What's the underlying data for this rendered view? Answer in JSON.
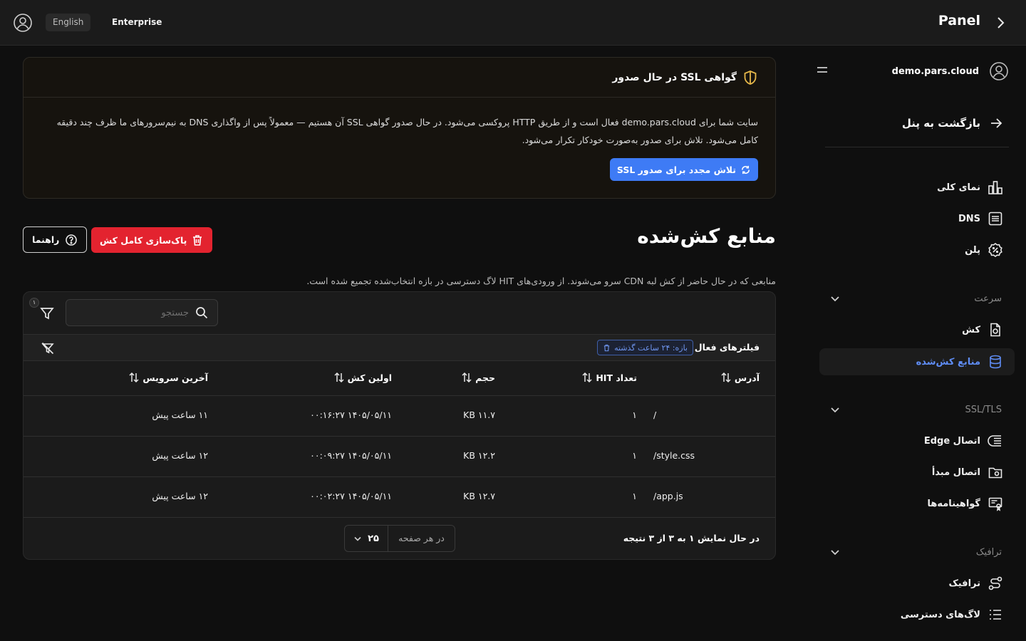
{
  "topbar": {
    "language": "English",
    "plan": "Enterprise",
    "title": "Panel"
  },
  "sidebar": {
    "domain": "demo.pars.cloud",
    "back_label": "بازگشت به پنل",
    "items": [
      {
        "label": "نمای کلی",
        "icon": "chart-bar-icon"
      },
      {
        "label": "DNS",
        "icon": "list-document-icon"
      },
      {
        "label": "پلن",
        "icon": "badge-percent-icon"
      }
    ],
    "groups": [
      {
        "label": "سرعت",
        "items": [
          {
            "label": "کش",
            "icon": "cache-file-icon"
          },
          {
            "label": "منابع کش‌شده",
            "icon": "database-icon",
            "active": true
          }
        ]
      },
      {
        "label": "SSL/TLS",
        "items": [
          {
            "label": "اتصال Edge",
            "icon": "edge-lines-icon"
          },
          {
            "label": "اتصال مبدأ",
            "icon": "folder-icon"
          },
          {
            "label": "گواهینامه‌ها",
            "icon": "certificate-icon"
          }
        ]
      },
      {
        "label": "ترافیک",
        "items": [
          {
            "label": "ترافیک",
            "icon": "route-icon"
          },
          {
            "label": "لاگ‌های دسترسی",
            "icon": "log-list-icon"
          }
        ]
      }
    ]
  },
  "ssl_notice": {
    "title": "گواهی SSL در حال صدور",
    "body": "سایت شما برای demo.pars.cloud فعال است و از طریق HTTP پروکسی می‌شود. در حال صدور گواهی SSL آن هستیم — معمولاً پس از واگذاری DNS به نیم‌سرورهای ما ظرف چند دقیقه کامل می‌شود. تلاش برای صدور به‌صورت خودکار تکرار می‌شود.",
    "retry_label": "تلاش مجدد برای صدور SSL"
  },
  "page": {
    "title": "منابع کش‌شده",
    "purge_label": "پاک‌سازی کامل کش",
    "guide_label": "راهنما",
    "description": "منابعی که در حال حاضر از کش لبه CDN سرو می‌شوند. از ورودی‌های HIT لاگ دسترسی در بازه انتخاب‌شده تجمیع شده است."
  },
  "table": {
    "search_placeholder": "جستجو",
    "filter_count": "۱",
    "active_filters_label": "فیلترهای فعال",
    "filter_chip": "بازه: ۲۴ ساعت گذشته",
    "columns": [
      "آدرس",
      "تعداد HIT",
      "حجم",
      "اولین کش",
      "آخرین سرویس"
    ],
    "rows": [
      {
        "path": "/",
        "hits": "۱",
        "size": "KB ۱۱.۷",
        "first_cache": "۱۴۰۵/۰۵/۱۱ ۰۰:۱۶:۲۷",
        "last_served": "۱۱ ساعت پیش"
      },
      {
        "path": "/style.css",
        "hits": "۱",
        "size": "KB ۱۲.۲",
        "first_cache": "۱۴۰۵/۰۵/۱۱ ۰۰:۰۹:۲۷",
        "last_served": "۱۲ ساعت پیش"
      },
      {
        "path": "/app.js",
        "hits": "۱",
        "size": "KB ۱۲.۷",
        "first_cache": "۱۴۰۵/۰۵/۱۱ ۰۰:۰۲:۲۷",
        "last_served": "۱۲ ساعت پیش"
      }
    ],
    "showing": "در حال نمایش ۱ به ۳ از ۳ نتیجه",
    "per_page_label": "در هر صفحه",
    "per_page_value": "۲۵"
  },
  "colors": {
    "accent": "#3e7bf5",
    "danger": "#e3232f",
    "warning": "#e6b84a",
    "active_text": "#5f8df5"
  }
}
